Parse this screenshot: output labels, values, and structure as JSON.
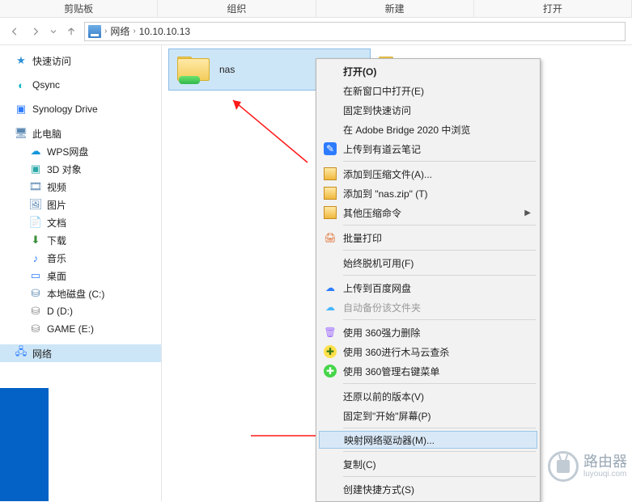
{
  "ribbon": {
    "tabs": [
      "剪贴板",
      "组织",
      "新建",
      "打开"
    ]
  },
  "address": {
    "root": "网络",
    "path": "10.10.10.13"
  },
  "sidebar": {
    "quick_access": "快速访问",
    "qsync": "Qsync",
    "synology": "Synology Drive",
    "this_pc": "此电脑",
    "items": [
      "WPS网盘",
      "3D 对象",
      "视频",
      "图片",
      "文档",
      "下载",
      "音乐",
      "桌面",
      "本地磁盘 (C:)",
      "D (D:)",
      "GAME (E:)"
    ],
    "network": "网络"
  },
  "folders": {
    "selected": "nas"
  },
  "context_menu": {
    "open": "打开(O)",
    "open_new": "在新窗口中打开(E)",
    "pin_quick": "固定到快速访问",
    "bridge": "在 Adobe Bridge 2020 中浏览",
    "youdao": "上传到有道云笔记",
    "add_archive": "添加到压缩文件(A)...",
    "add_zip": "添加到 \"nas.zip\" (T)",
    "other_compress": "其他压缩命令",
    "batch_print": "批量打印",
    "offline": "始终脱机可用(F)",
    "baidu": "上传到百度网盘",
    "auto_backup": "自动备份该文件夹",
    "del360": "使用 360强力删除",
    "scan360": "使用 360进行木马云查杀",
    "menu360": "使用 360管理右键菜单",
    "restore": "还原以前的版本(V)",
    "pin_start": "固定到\"开始\"屏幕(P)",
    "map_drive": "映射网络驱动器(M)...",
    "copy": "复制(C)",
    "shortcut": "创建快捷方式(S)"
  },
  "watermark": {
    "title": "路由器",
    "url": "luyouqi.com"
  }
}
